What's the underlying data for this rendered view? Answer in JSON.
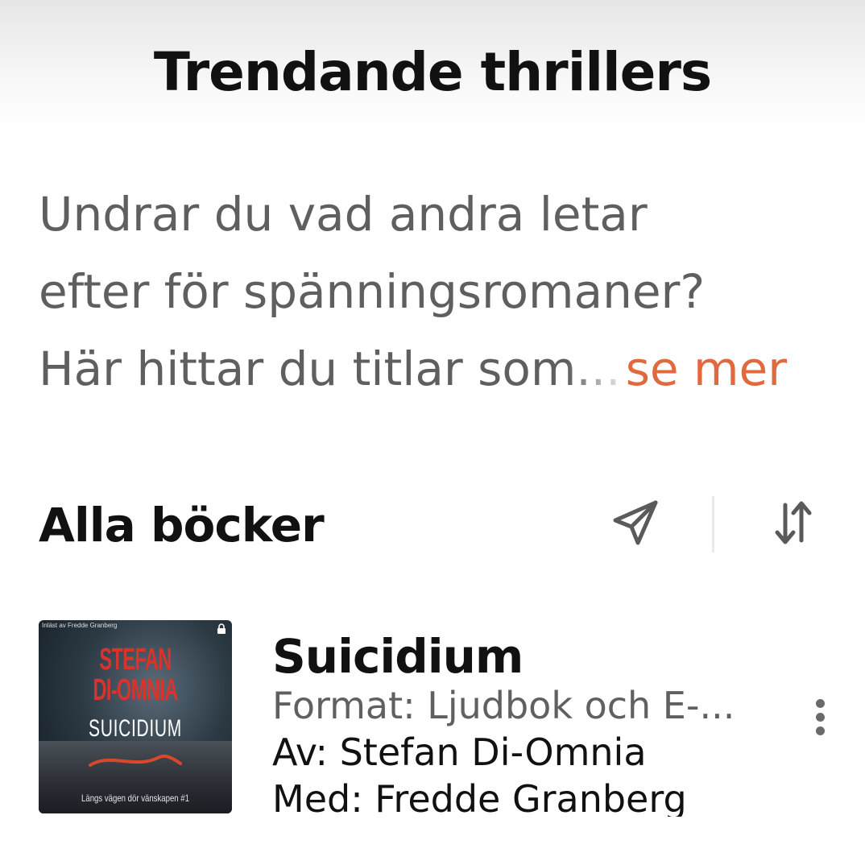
{
  "header": {
    "title": "Trendande thrillers"
  },
  "description": {
    "line1": "Undrar du vad andra letar",
    "line2": "efter för spänningsromaner?",
    "line3_visible": "Här hittar du titlar so",
    "line3_faded": "m...",
    "see_more_label": "se mer"
  },
  "section": {
    "title": "Alla böcker",
    "share_icon": "send-icon",
    "sort_icon": "sort-icon"
  },
  "books": [
    {
      "title": "Suicidium",
      "format": "Format: Ljudbok och E-...",
      "author": "Av: Stefan Di-Omnia",
      "narrator": "Med: Fredde Granberg",
      "cover": {
        "narrator_text": "Inläst av Fredde Granberg",
        "author_line1": "STEFAN",
        "author_line2": "DI-OMNIA",
        "title": "SUICIDIUM",
        "series": "Längs vägen dör vänskapen #1"
      }
    }
  ],
  "colors": {
    "accent": "#e06a3e",
    "text_primary": "#111111",
    "text_secondary": "#5f5f5f"
  }
}
